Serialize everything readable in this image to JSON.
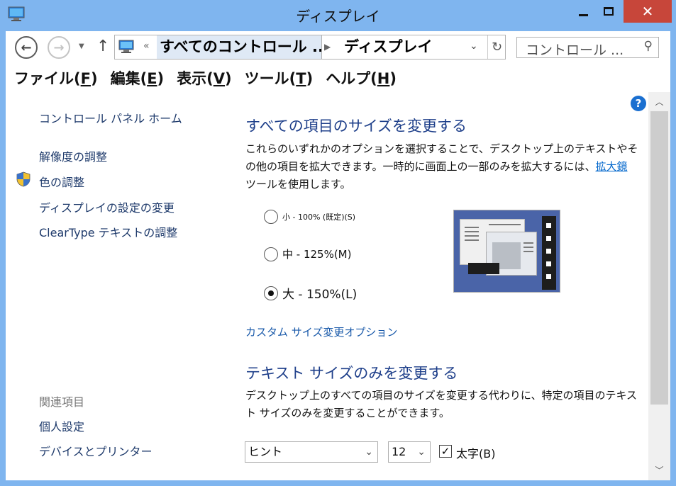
{
  "window": {
    "title": "ディスプレイ",
    "controls": {
      "minimize": "minimize",
      "maximize": "maximize",
      "close": "✕"
    }
  },
  "address_bar": {
    "breadcrumb_parent": "すべてのコントロール ...",
    "breadcrumb_current": "ディスプレイ",
    "search_placeholder": "コントロール ..."
  },
  "menu": [
    {
      "label": "ファイル(",
      "key": "F",
      "end": ")"
    },
    {
      "label": "編集(",
      "key": "E",
      "end": ")"
    },
    {
      "label": "表示(",
      "key": "V",
      "end": ")"
    },
    {
      "label": "ツール(",
      "key": "T",
      "end": ")"
    },
    {
      "label": "ヘルプ(",
      "key": "H",
      "end": ")"
    }
  ],
  "sidebar": {
    "home": "コントロール パネル ホーム",
    "links": [
      "解像度の調整",
      "色の調整",
      "ディスプレイの設定の変更",
      "ClearType テキストの調整"
    ],
    "related_heading": "関連項目",
    "related": [
      "個人設定",
      "デバイスとプリンター"
    ]
  },
  "main": {
    "section1_title": "すべての項目のサイズを変更する",
    "section1_text_pre": "これらのいずれかのオプションを選択することで、デスクトップ上のテキストやその他の項目を拡大できます。一時的に画面上の一部のみを拡大するには、",
    "section1_link": "拡大鏡",
    "section1_text_post": "ツールを使用します。",
    "options": [
      {
        "label": "小 - 100% (既定)(S)",
        "checked": false
      },
      {
        "label": "中 - 125%(M)",
        "checked": false
      },
      {
        "label": "大 - 150%(L)",
        "checked": true
      }
    ],
    "custom_link": "カスタム サイズ変更オプション",
    "section2_title": "テキスト サイズのみを変更する",
    "section2_text": "デスクトップ上のすべての項目のサイズを変更する代わりに、特定の項目のテキスト サイズのみを変更することができます。",
    "item_select": "ヒント",
    "size_select": "12",
    "bold_label": "太字(B)",
    "bold_checked": true
  },
  "colors": {
    "frame": "#7fb5ef",
    "heading_blue": "#1e3f8a",
    "link_blue": "#0066cc",
    "close_red": "#c7463a"
  }
}
